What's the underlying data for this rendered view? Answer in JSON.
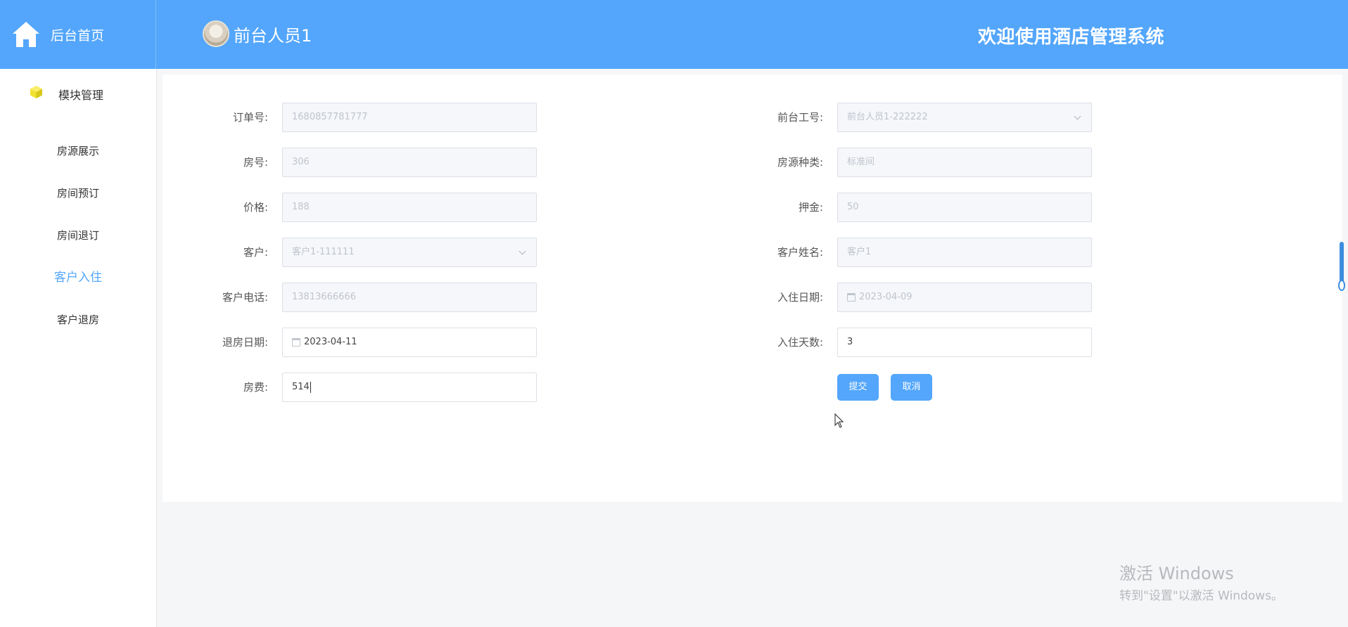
{
  "header": {
    "brand_label": "后台首页",
    "user_name": "前台人员1",
    "welcome": "欢迎使用酒店管理系统"
  },
  "sidebar": {
    "module_label": "模块管理",
    "items": [
      {
        "label": "房源展示",
        "active": false
      },
      {
        "label": "房间预订",
        "active": false
      },
      {
        "label": "房间退订",
        "active": false
      },
      {
        "label": "客户入住",
        "active": true
      },
      {
        "label": "客户退房",
        "active": false
      }
    ]
  },
  "form": {
    "order_no": {
      "label": "订单号:",
      "value": "1680857781777"
    },
    "staff_no": {
      "label": "前台工号:",
      "value": "前台人员1-222222"
    },
    "room_no": {
      "label": "房号:",
      "value": "306"
    },
    "room_type": {
      "label": "房源种类:",
      "value": "标准间"
    },
    "price": {
      "label": "价格:",
      "value": "188"
    },
    "deposit": {
      "label": "押金:",
      "value": "50"
    },
    "customer": {
      "label": "客户:",
      "value": "客户1-111111"
    },
    "customer_name": {
      "label": "客户姓名:",
      "value": "客户1"
    },
    "customer_phone": {
      "label": "客户电话:",
      "value": "13813666666"
    },
    "checkin_date": {
      "label": "入住日期:",
      "value": "2023-04-09"
    },
    "checkout_date": {
      "label": "退房日期:",
      "value": "2023-04-11"
    },
    "stay_days": {
      "label": "入住天数:",
      "value": "3"
    },
    "room_fee": {
      "label": "房费:",
      "value": "514"
    },
    "submit_label": "提交",
    "cancel_label": "取消"
  },
  "watermark": {
    "title": "激活 Windows",
    "subtitle": "转到\"设置\"以激活 Windows。"
  },
  "colors": {
    "primary": "#53a6fb",
    "accent_yellow": "#f2e230"
  }
}
